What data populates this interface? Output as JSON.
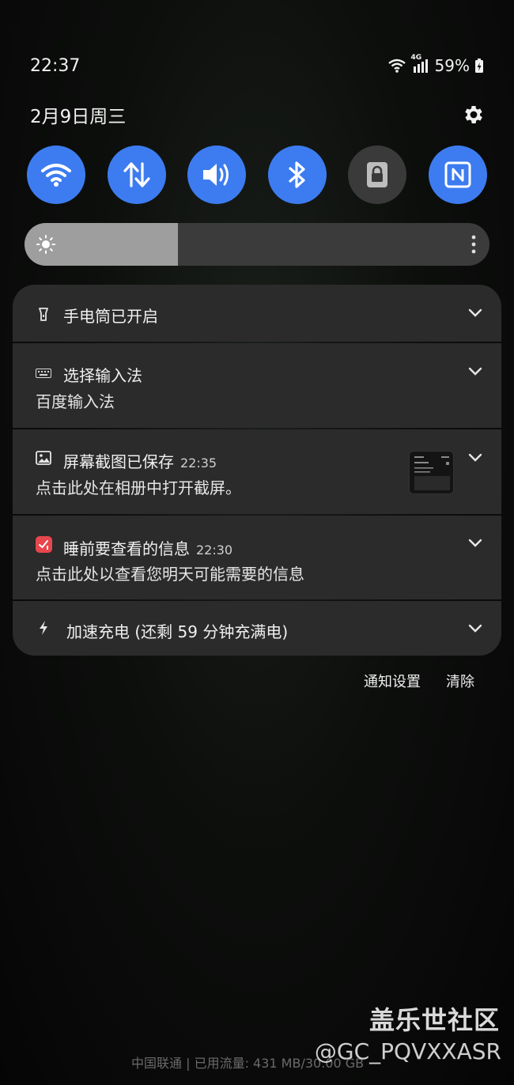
{
  "status_bar": {
    "time": "22:37",
    "network_label": "4G",
    "battery": "59%"
  },
  "date": "2月9日周三",
  "quick_toggles": [
    {
      "name": "wifi-icon",
      "active": true
    },
    {
      "name": "mobile-data-icon",
      "active": true
    },
    {
      "name": "volume-icon",
      "active": true
    },
    {
      "name": "bluetooth-icon",
      "active": true
    },
    {
      "name": "lock-icon",
      "active": false
    },
    {
      "name": "nfc-icon",
      "active": true
    }
  ],
  "brightness": {
    "level": 0.33
  },
  "notifications": [
    {
      "icon": "flashlight-icon",
      "title": "手电筒已开启",
      "time": "",
      "body": ""
    },
    {
      "icon": "keyboard-icon",
      "title": "选择输入法",
      "time": "",
      "body": "百度输入法"
    },
    {
      "icon": "image-icon",
      "title": "屏幕截图已保存",
      "time": "22:35",
      "body": "点击此处在相册中打开截屏。"
    },
    {
      "icon": "reminder-icon",
      "title": "睡前要查看的信息",
      "time": "22:30",
      "body": "点击此处以查看您明天可能需要的信息"
    },
    {
      "icon": "charging-icon",
      "title": "加速充电 (还剩 59 分钟充满电)",
      "time": "",
      "body": ""
    }
  ],
  "actions": {
    "settings_label": "通知设置",
    "clear_label": "清除"
  },
  "carrier_info": "中国联通 | 已用流量: 431 MB/30.00 GB",
  "watermark": {
    "title": "盖乐世社区",
    "handle": "@GC_PQVXXASR"
  },
  "colors": {
    "accent": "#3d7cf0",
    "card": "#2b2b2b",
    "reminder_icon": "#e8464d"
  }
}
